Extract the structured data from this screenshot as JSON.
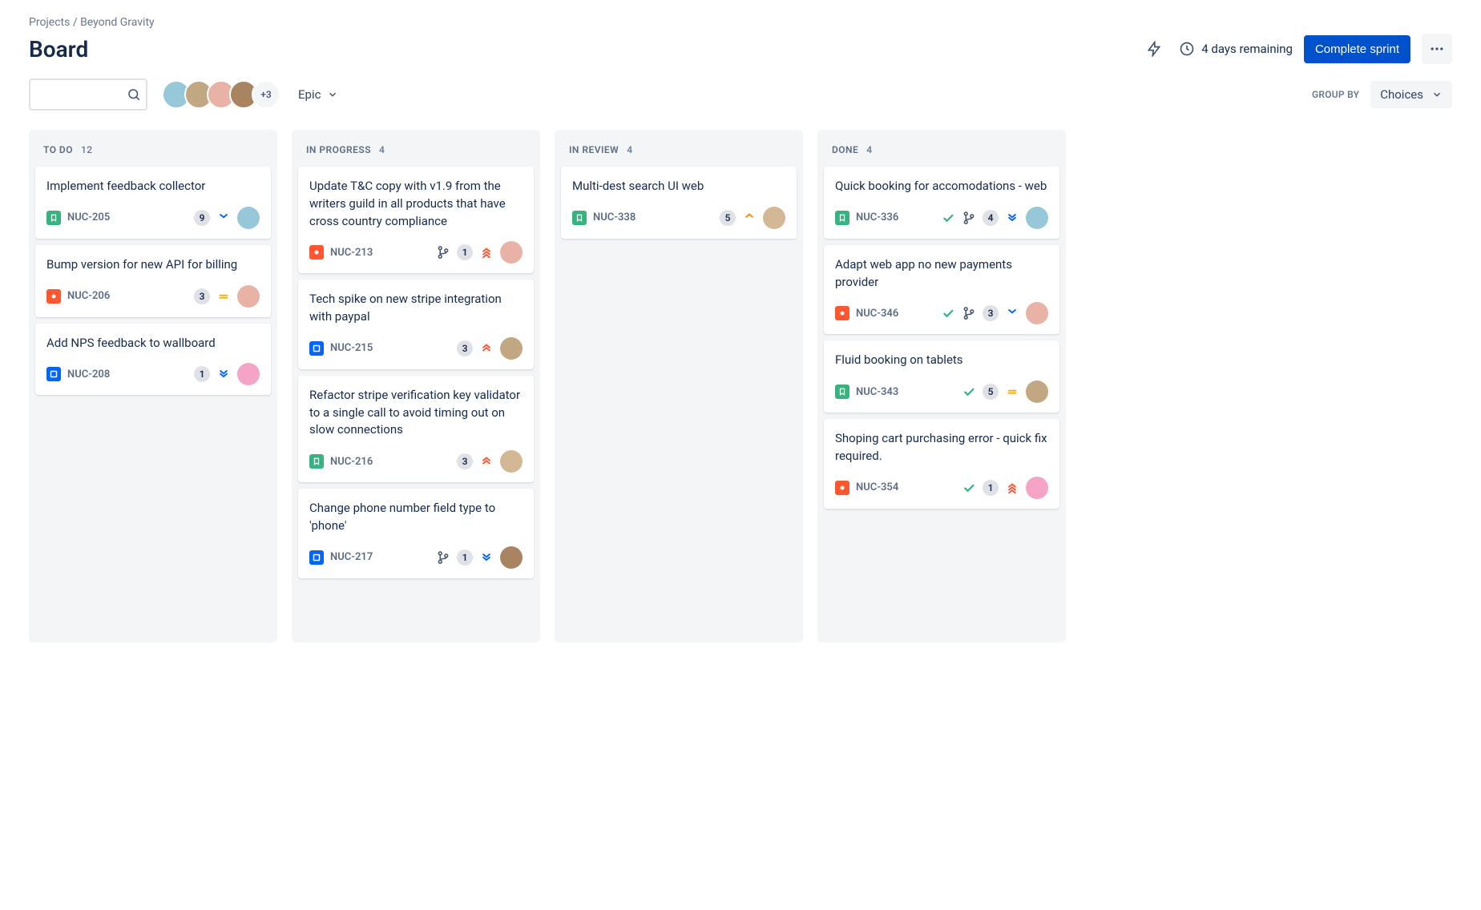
{
  "breadcrumb": {
    "root": "Projects",
    "project": "Beyond Gravity"
  },
  "title": "Board",
  "header": {
    "remaining": "4 days remaining",
    "complete_sprint": "Complete sprint"
  },
  "toolbar": {
    "avatars_more": "+3",
    "epic_label": "Epic",
    "group_by_label": "GROUP BY",
    "choices_label": "Choices"
  },
  "columns": [
    {
      "key": "todo",
      "title": "TO DO",
      "count": 12
    },
    {
      "key": "inprogress",
      "title": "IN PROGRESS",
      "count": 4
    },
    {
      "key": "inreview",
      "title": "IN REVIEW",
      "count": 4
    },
    {
      "key": "done",
      "title": "DONE",
      "count": 4
    }
  ],
  "cards": {
    "todo": [
      {
        "title": "Implement feedback collector",
        "type": "story",
        "key": "NUC-205",
        "count": 9,
        "priority": "low",
        "assignee": "a1"
      },
      {
        "title": "Bump version for new API for billing",
        "type": "bug",
        "key": "NUC-206",
        "count": 3,
        "priority": "medium",
        "assignee": "a2"
      },
      {
        "title": "Add NPS feedback to wallboard",
        "type": "task",
        "key": "NUC-208",
        "count": 1,
        "priority": "lowest",
        "assignee": "a3"
      }
    ],
    "inprogress": [
      {
        "title": "Update T&C copy with v1.9 from the writers guild in all products that have cross country compliance",
        "type": "bug",
        "key": "NUC-213",
        "branch": true,
        "count": 1,
        "priority": "highest",
        "assignee": "a2"
      },
      {
        "title": "Tech spike on new stripe integration with paypal",
        "type": "task",
        "key": "NUC-215",
        "count": 3,
        "priority": "high",
        "assignee": "a4"
      },
      {
        "title": "Refactor stripe verification key validator to a single call to avoid timing out on slow connections",
        "type": "story",
        "key": "NUC-216",
        "count": 3,
        "priority": "high",
        "assignee": "a5"
      },
      {
        "title": "Change phone number field type to 'phone'",
        "type": "task",
        "key": "NUC-217",
        "branch": true,
        "count": 1,
        "priority": "lowest",
        "assignee": "a6"
      }
    ],
    "inreview": [
      {
        "title": "Multi-dest search UI web",
        "type": "story",
        "key": "NUC-338",
        "count": 5,
        "priority": "mediumUp",
        "assignee": "a5"
      }
    ],
    "done": [
      {
        "title": "Quick booking for accomodations - web",
        "type": "story",
        "key": "NUC-336",
        "check": true,
        "branch": true,
        "count": 4,
        "priority": "lowest",
        "assignee": "a1"
      },
      {
        "title": "Adapt web app no new payments provider",
        "type": "bug",
        "key": "NUC-346",
        "check": true,
        "branch": true,
        "count": 3,
        "priority": "low",
        "assignee": "a2"
      },
      {
        "title": "Fluid booking on tablets",
        "type": "story",
        "key": "NUC-343",
        "check": true,
        "count": 5,
        "priority": "medium",
        "assignee": "a4"
      },
      {
        "title": "Shoping cart purchasing error - quick fix required.",
        "type": "bug",
        "key": "NUC-354",
        "check": true,
        "count": 1,
        "priority": "highest",
        "assignee": "a3"
      }
    ]
  },
  "avatarColors": {
    "a1": "#96c8da",
    "a2": "#e8b3a6",
    "a3": "#f5a3c7",
    "a4": "#c2a882",
    "a5": "#d4b896",
    "a6": "#a88560"
  }
}
